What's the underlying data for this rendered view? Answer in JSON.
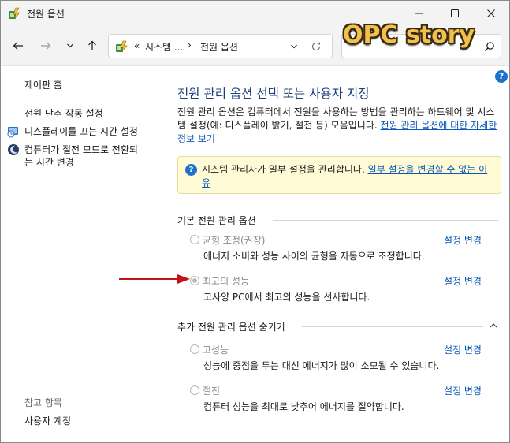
{
  "window": {
    "title": "전원 옵션"
  },
  "address": {
    "chevron": "«",
    "crumb1": "시스템 ...",
    "separator": "›",
    "crumb2": "전원 옵션"
  },
  "watermark": "OPC story",
  "left_pane": {
    "control_panel_home": "제어판 홈",
    "power_button_settings": "전원 단추 작동 설정",
    "display_off_time": "디스플레이를 끄는 시간 설정",
    "sleep_time_line1": "컴퓨터가 절전 모드로 전환되",
    "sleep_time_line2": "는 시간 변경",
    "see_also": "참고 항목",
    "user_accounts": "사용자 계정"
  },
  "main": {
    "title": "전원 관리 옵션 선택 또는 사용자 지정",
    "desc_text": "전원 관리 옵션은 컴퓨터에서 전원을 사용하는 방법을 관리하는 하드웨어 및 시스템 설정(예: 디스플레이 밝기, 절전 등) 모음입니다. ",
    "desc_link": "전원 관리 옵션에 대한 자세한 정보 보기",
    "info_text": "시스템 관리자가 일부 설정을 관리합니다. ",
    "info_link": "일부 설정을 변경할 수 없는 이유",
    "basic_section": "기본 전원 관리 옵션",
    "extra_section": "추가 전원 관리 옵션 숨기기",
    "change_label": "설정 변경",
    "plans": [
      {
        "name": "균형 조정(권장)",
        "desc": "에너지 소비와 성능 사이의 균형을 자동으로 조정합니다.",
        "checked": false
      },
      {
        "name": "최고의 성능",
        "desc": "고사양 PC에서 최고의 성능을 선사합니다.",
        "checked": true
      },
      {
        "name": "고성능",
        "desc": "성능에 중점을 두는 대신 에너지가 많이 소모될 수 있습니다.",
        "checked": false
      },
      {
        "name": "절전",
        "desc": "컴퓨터 성능을 최대로 낮추어 에너지를 절약합니다.",
        "checked": false
      }
    ]
  },
  "colors": {
    "title_blue": "#1a3f7a",
    "link_blue": "#0b58b8",
    "info_bg": "#fffbd6",
    "arrow_red": "#c0161b"
  }
}
